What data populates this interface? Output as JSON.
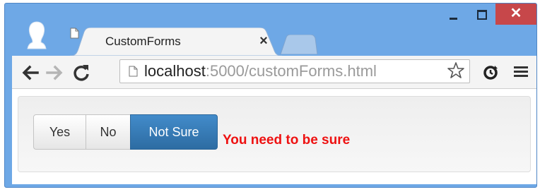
{
  "tab": {
    "title": "CustomForms",
    "close": "×"
  },
  "toolbar": {
    "url_host": "localhost",
    "url_rest": ":5000/customForms.html"
  },
  "window_controls": {
    "close": "✕"
  },
  "form": {
    "options": [
      "Yes",
      "No",
      "Not Sure"
    ],
    "selected": "Not Sure",
    "validation_message": "You need to be sure"
  },
  "colors": {
    "frame": "#6ea8e6",
    "selected_button": "#428bca",
    "error_text": "#ee1111",
    "close_button": "#c7474a"
  }
}
